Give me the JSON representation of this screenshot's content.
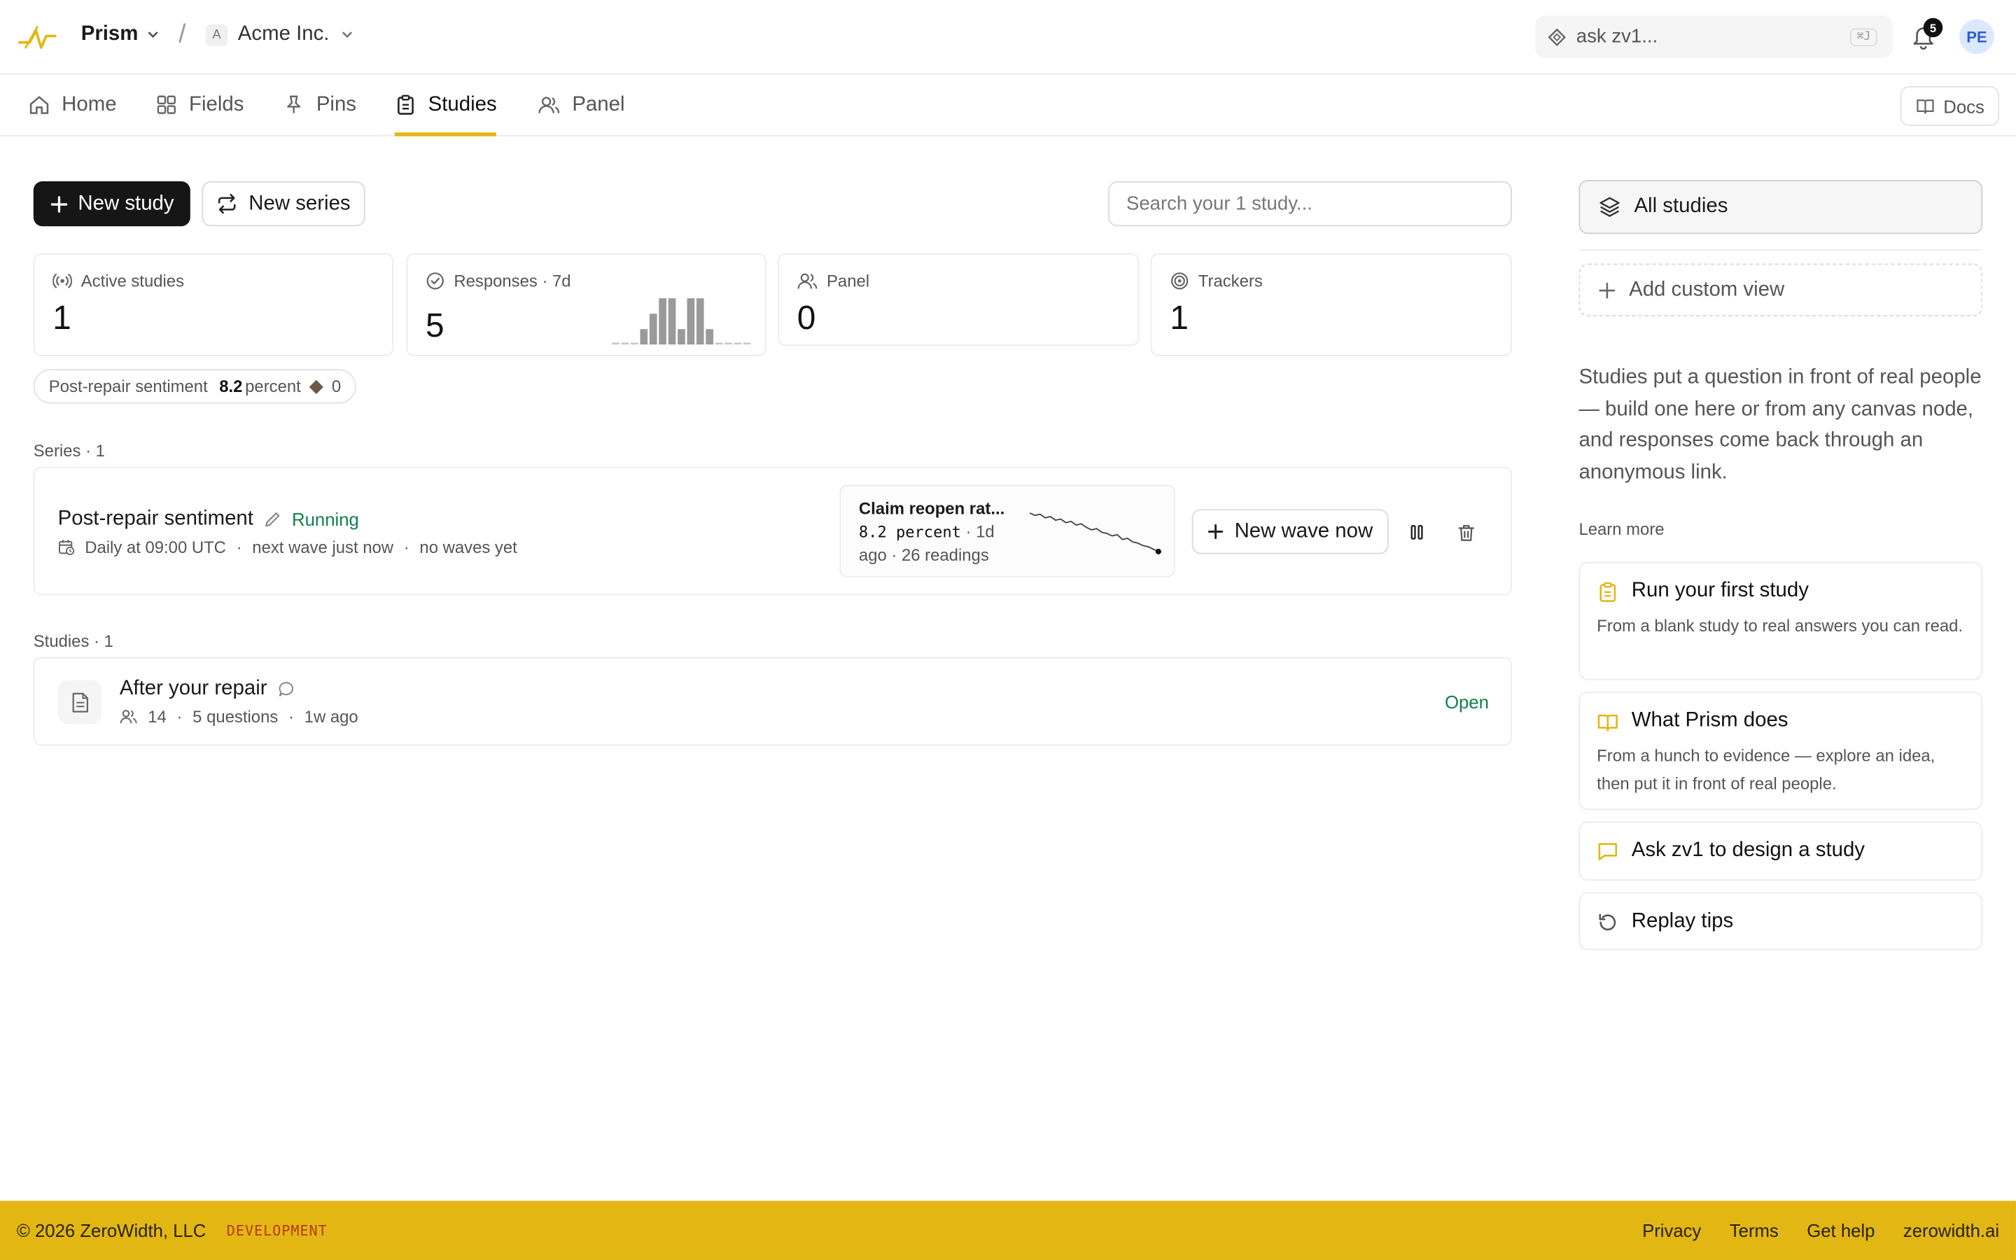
{
  "header": {
    "brand": "Prism",
    "org_badge": "A",
    "org": "Acme Inc.",
    "ask_placeholder": "ask zv1...",
    "ask_shortcut": "⌘J",
    "notifications_count": "5",
    "avatar_initials": "PE"
  },
  "nav": {
    "tabs": [
      {
        "label": "Home",
        "icon": "home-icon",
        "active": false
      },
      {
        "label": "Fields",
        "icon": "grid-icon",
        "active": false
      },
      {
        "label": "Pins",
        "icon": "pin-icon",
        "active": false
      },
      {
        "label": "Studies",
        "icon": "clipboard-icon",
        "active": true
      },
      {
        "label": "Panel",
        "icon": "users-icon",
        "active": false
      }
    ],
    "docs_label": "Docs"
  },
  "toolbar": {
    "new_study": "New study",
    "new_series": "New series",
    "search_placeholder": "Search your 1 study..."
  },
  "stats": [
    {
      "label": "Active studies",
      "value": "1",
      "icon": "broadcast-icon"
    },
    {
      "label": "Responses · 7d",
      "value": "5",
      "icon": "check-circle-icon"
    },
    {
      "label": "Panel",
      "value": "0",
      "icon": "users-icon"
    },
    {
      "label": "Trackers",
      "value": "1",
      "icon": "target-icon"
    }
  ],
  "responses_histogram": [
    0,
    0,
    0,
    1,
    2,
    3,
    3,
    1,
    3,
    3,
    1,
    0,
    0,
    0,
    0
  ],
  "metric_pill": {
    "name": "Post-repair sentiment",
    "value": "8.2",
    "unit": "percent",
    "delta": "0"
  },
  "series_section": {
    "label": "Series · 1",
    "item": {
      "title": "Post-repair sentiment",
      "status": "Running",
      "schedule": "Daily at 09:00 UTC",
      "next_wave": "next wave just now",
      "waves": "no waves yet",
      "tracker_title": "Claim reopen rat...",
      "tracker_value": "8.2 percent",
      "tracker_meta_a": " · 1d",
      "tracker_meta_b": "ago · 26 readings",
      "tracker_trend": [
        9.8,
        9.7,
        9.75,
        9.6,
        9.65,
        9.5,
        9.55,
        9.4,
        9.45,
        9.3,
        9.35,
        9.2,
        9.1,
        9.15,
        9.0,
        8.95,
        8.85,
        8.9,
        8.7,
        8.75,
        8.6,
        8.55,
        8.45,
        8.4,
        8.3,
        8.2
      ],
      "new_wave_label": "New wave now"
    }
  },
  "studies_section": {
    "label": "Studies · 1",
    "item": {
      "title": "After your repair",
      "participants": "14",
      "questions": "5 questions",
      "age": "1w ago",
      "status": "Open"
    }
  },
  "sidebar": {
    "all_studies": "All studies",
    "add_view": "Add custom view",
    "blurb": "Studies put a question in front of real people — build one here or from any canvas node, and responses come back through an anonymous link.",
    "learn_more": "Learn more",
    "cards": [
      {
        "title": "Run your first study",
        "desc": "From a blank study to real answers you can read.",
        "icon": "clipboard-icon"
      },
      {
        "title": "What Prism does",
        "desc": "From a hunch to evidence — explore an idea, then put it in front of real people.",
        "icon": "book-icon"
      },
      {
        "title": "Ask zv1 to design a study",
        "desc": "",
        "icon": "chat-icon"
      },
      {
        "title": "Replay tips",
        "desc": "",
        "icon": "replay-icon"
      }
    ]
  },
  "footer": {
    "copyright": "© 2026 ZeroWidth, LLC",
    "env": "DEVELOPMENT",
    "links": [
      "Privacy",
      "Terms",
      "Get help",
      "zerowidth.ai"
    ]
  },
  "colors": {
    "accent": "#e2b714",
    "running": "#11804b",
    "env": "#b83a12"
  }
}
